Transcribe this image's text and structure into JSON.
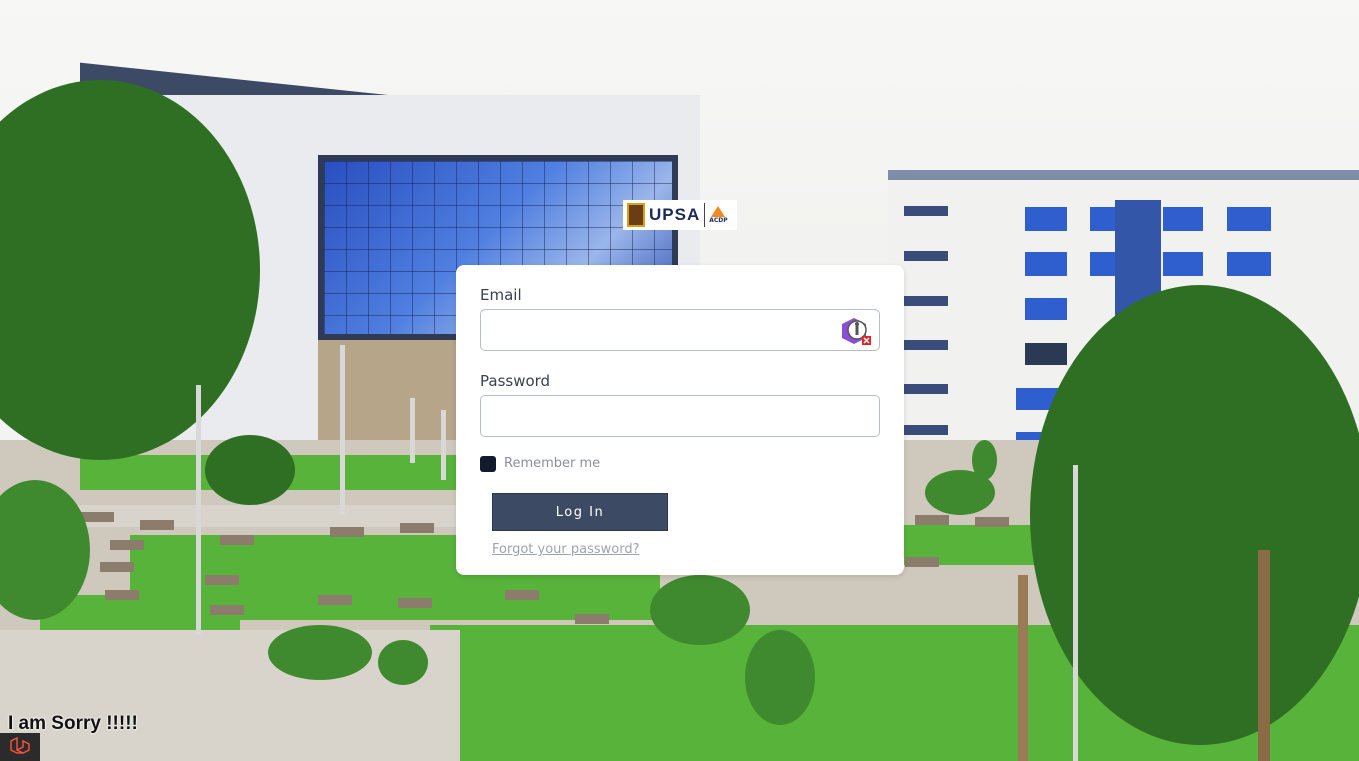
{
  "logo": {
    "brand": "UPSA",
    "partner": "ACDP"
  },
  "login_form": {
    "email_label": "Email",
    "email_value": "",
    "password_label": "Password",
    "password_value": "",
    "remember_label": "Remember me",
    "remember_checked": true,
    "submit_label": "Log In",
    "forgot_link": "Forgot your password?"
  },
  "footer": {
    "sorry_text": "I am Sorry !!!!!"
  },
  "icons": {
    "password_manager": "password-manager-icon",
    "framework_badge": "laravel-icon"
  },
  "colors": {
    "button_bg": "#3d4a63",
    "checkbox_bg": "#111a2e",
    "card_bg": "#ffffff"
  }
}
